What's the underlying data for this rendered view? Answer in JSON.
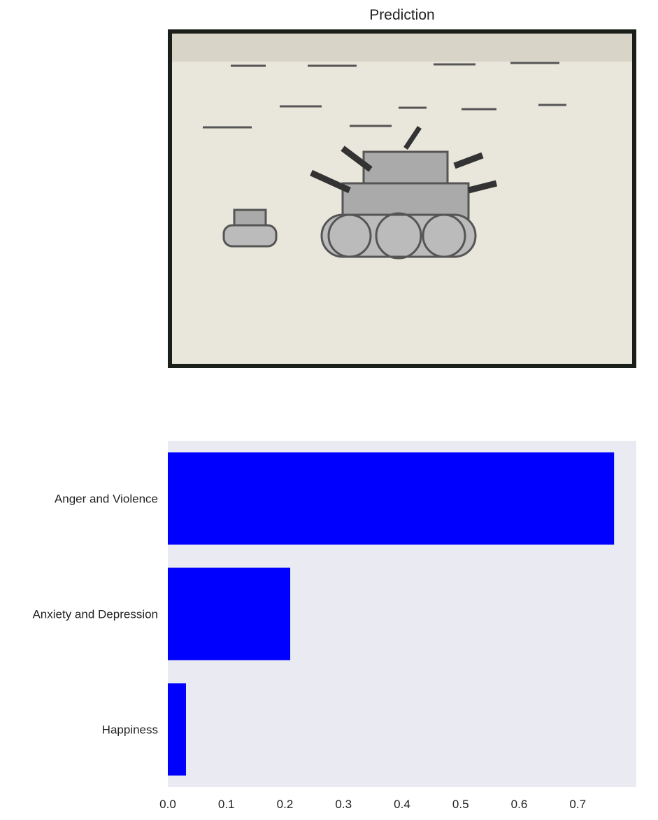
{
  "title": "Prediction",
  "image": {
    "description_icon": "child-drawing-of-tanks-and-planes"
  },
  "chart_data": {
    "type": "bar",
    "orientation": "horizontal",
    "categories": [
      "Anger and Violence",
      "Anxiety and Depression",
      "Happiness"
    ],
    "values": [
      0.762,
      0.209,
      0.031
    ],
    "xlim": [
      0.0,
      0.8
    ],
    "xticks": [
      "0.0",
      "0.1",
      "0.2",
      "0.3",
      "0.4",
      "0.5",
      "0.6",
      "0.7"
    ],
    "bar_color": "#0000ff",
    "background": "#eaeaf2",
    "grid": false
  }
}
